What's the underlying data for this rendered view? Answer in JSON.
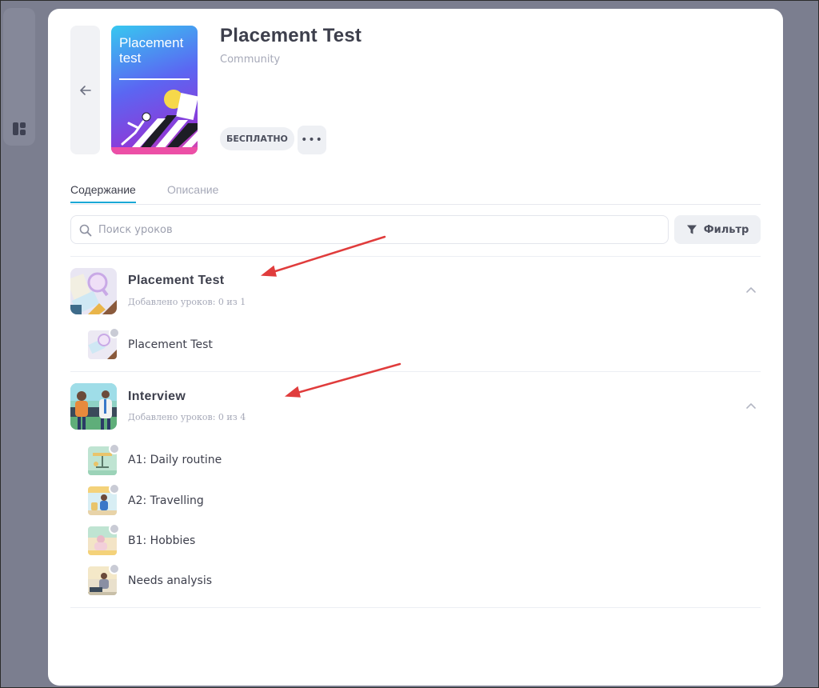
{
  "course": {
    "cover_title": "Placement test",
    "title": "Placement Test",
    "subtitle": "Community",
    "price_badge": "БЕСПЛАТНО",
    "more_label": "•••"
  },
  "tabs": [
    {
      "label": "Содержание",
      "active": true
    },
    {
      "label": "Описание",
      "active": false
    }
  ],
  "search": {
    "placeholder": "Поиск уроков",
    "value": ""
  },
  "filter": {
    "label": "Фильтр"
  },
  "sections": [
    {
      "title": "Placement Test",
      "count": "Добавлено уроков: 0 из 1",
      "lessons": [
        {
          "label": "Placement Test"
        }
      ]
    },
    {
      "title": "Interview",
      "count": "Добавлено уроков: 0 из 4",
      "lessons": [
        {
          "label": "A1: Daily routine"
        },
        {
          "label": "A2: Travelling"
        },
        {
          "label": "B1: Hobbies"
        },
        {
          "label": "Needs analysis"
        }
      ]
    }
  ],
  "colors": {
    "accent": "#1aa8d6",
    "backdrop": "#7b7e8f",
    "annotation_arrow": "#e03c3c"
  },
  "icons": [
    "grid-icon",
    "arrow-left-icon",
    "search-icon",
    "filter-icon",
    "chevron-up-icon",
    "eye-icon"
  ]
}
